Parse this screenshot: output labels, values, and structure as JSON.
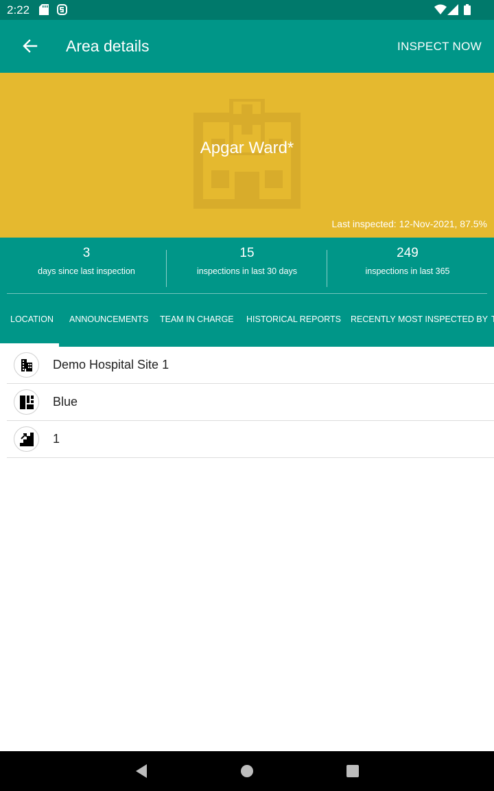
{
  "status_bar": {
    "time": "2:22"
  },
  "app_bar": {
    "title": "Area details",
    "action_label": "INSPECT NOW"
  },
  "hero": {
    "area_name": "Apgar Ward*",
    "last_inspected": "Last inspected: 12-Nov-2021, 87.5%",
    "background_color": "#e5b92f"
  },
  "stats": [
    {
      "value": "3",
      "label": "days since last inspection"
    },
    {
      "value": "15",
      "label": "inspections in last 30 days"
    },
    {
      "value": "249",
      "label": "inspections in last 365"
    }
  ],
  "tabs": [
    {
      "label": "LOCATION",
      "selected": true
    },
    {
      "label": "ANNOUNCEMENTS"
    },
    {
      "label": "TEAM IN CHARGE"
    },
    {
      "label": "HISTORICAL REPORTS"
    },
    {
      "label": "RECENTLY MOST INSPECTED BY"
    },
    {
      "label": "T"
    }
  ],
  "location_items": [
    {
      "icon": "building-icon",
      "text": "Demo Hospital Site 1"
    },
    {
      "icon": "block-icon",
      "text": "Blue"
    },
    {
      "icon": "floor-icon",
      "text": "1"
    }
  ],
  "colors": {
    "primary": "#009688",
    "primary_dark": "#00796b",
    "accent": "#e5b92f"
  }
}
